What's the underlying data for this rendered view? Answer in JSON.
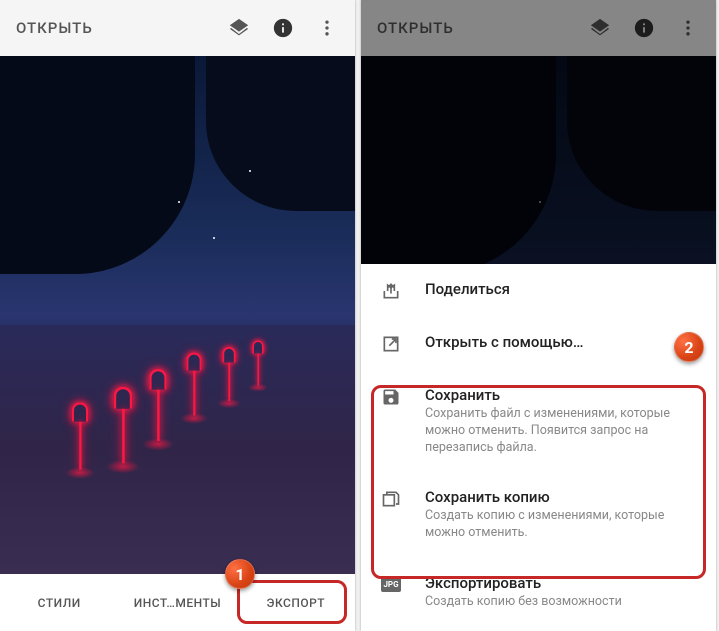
{
  "toolbar": {
    "title": "ОТКРЫТЬ"
  },
  "tabs": {
    "styles": "СТИЛИ",
    "tools": "ИНСТ…МЕНТЫ",
    "export": "ЭКСПОРТ"
  },
  "sheet": {
    "share": {
      "title": "Поделиться"
    },
    "openWith": {
      "title": "Открыть с помощью…"
    },
    "save": {
      "title": "Сохранить",
      "desc": "Сохранить файл с изменениями, которые можно отменить. Появится запрос на перезапись файла."
    },
    "saveCopy": {
      "title": "Сохранить копию",
      "desc": "Создать копию с изменениями, которые можно отменить."
    },
    "export": {
      "title": "Экспортировать",
      "desc": "Создать копию без возможности"
    },
    "jpgLabel": "JPG"
  },
  "badges": {
    "one": "1",
    "two": "2"
  }
}
